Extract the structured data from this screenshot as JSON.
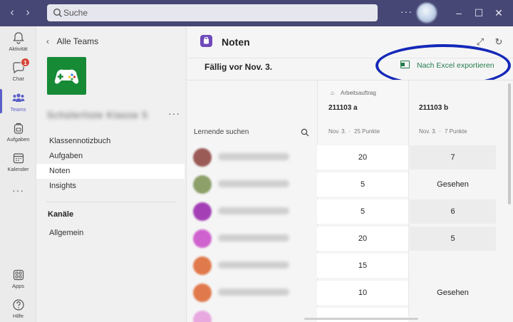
{
  "titlebar": {
    "search_placeholder": "Suche",
    "more": "···",
    "back_arrow": "‹",
    "forward_arrow": "›",
    "minimize": "–",
    "maximize": "☐",
    "close": "✕"
  },
  "rail": {
    "items": [
      {
        "label": "Aktivität",
        "icon": "bell-icon"
      },
      {
        "label": "Chat",
        "icon": "chat-icon",
        "badge": "1"
      },
      {
        "label": "Teams",
        "icon": "teams-icon",
        "active": true
      },
      {
        "label": "Aufgaben",
        "icon": "backpack-icon"
      },
      {
        "label": "Kalender",
        "icon": "calendar-icon"
      },
      {
        "label": "···",
        "icon": "more-icon"
      },
      {
        "label": "Apps",
        "icon": "apps-icon"
      },
      {
        "label": "Hilfe",
        "icon": "help-icon"
      }
    ]
  },
  "team_panel": {
    "back_label": "Alle Teams",
    "team_name": "Schülerliste Klasse 5",
    "more": "···",
    "menu": [
      "Klassennotizbuch",
      "Aufgaben",
      "Noten",
      "Insights"
    ],
    "selected_menu": "Noten",
    "channels_heading": "Kanäle",
    "channels": [
      "Allgemein"
    ]
  },
  "main": {
    "app_title": "Noten",
    "due_text": "Fällig vor Nov. 3.",
    "export_label": "Nach Excel exportieren",
    "student_search": "Lernende suchen",
    "columns": [
      {
        "tag": "Arbeitsauftrag",
        "title": "211103 a",
        "date": "Nov. 3.",
        "points": "25 Punkte"
      },
      {
        "tag": "",
        "title": "211103 b",
        "date": "Nov. 3.",
        "points": "7 Punkte"
      }
    ],
    "rows": [
      {
        "avatar_color": "#9a5a55",
        "a": "20",
        "b": "7",
        "b_filled": true
      },
      {
        "avatar_color": "#8da06a",
        "a": "5",
        "b": "Gesehen",
        "b_filled": false
      },
      {
        "avatar_color": "#a43fb6",
        "a": "5",
        "b": "6",
        "b_filled": true
      },
      {
        "avatar_color": "#d062cf",
        "a": "20",
        "b": "5",
        "b_filled": true
      },
      {
        "avatar_color": "#e07a4c",
        "a": "15",
        "b": "",
        "b_filled": false
      },
      {
        "avatar_color": "#e07a4c",
        "a": "10",
        "b": "Gesehen",
        "b_filled": false
      }
    ]
  },
  "colors": {
    "titlebar": "#464775",
    "accent": "#5b5fc7",
    "excel_green": "#237b4b",
    "highlight": "#1428b8",
    "team_logo": "#178a36"
  }
}
